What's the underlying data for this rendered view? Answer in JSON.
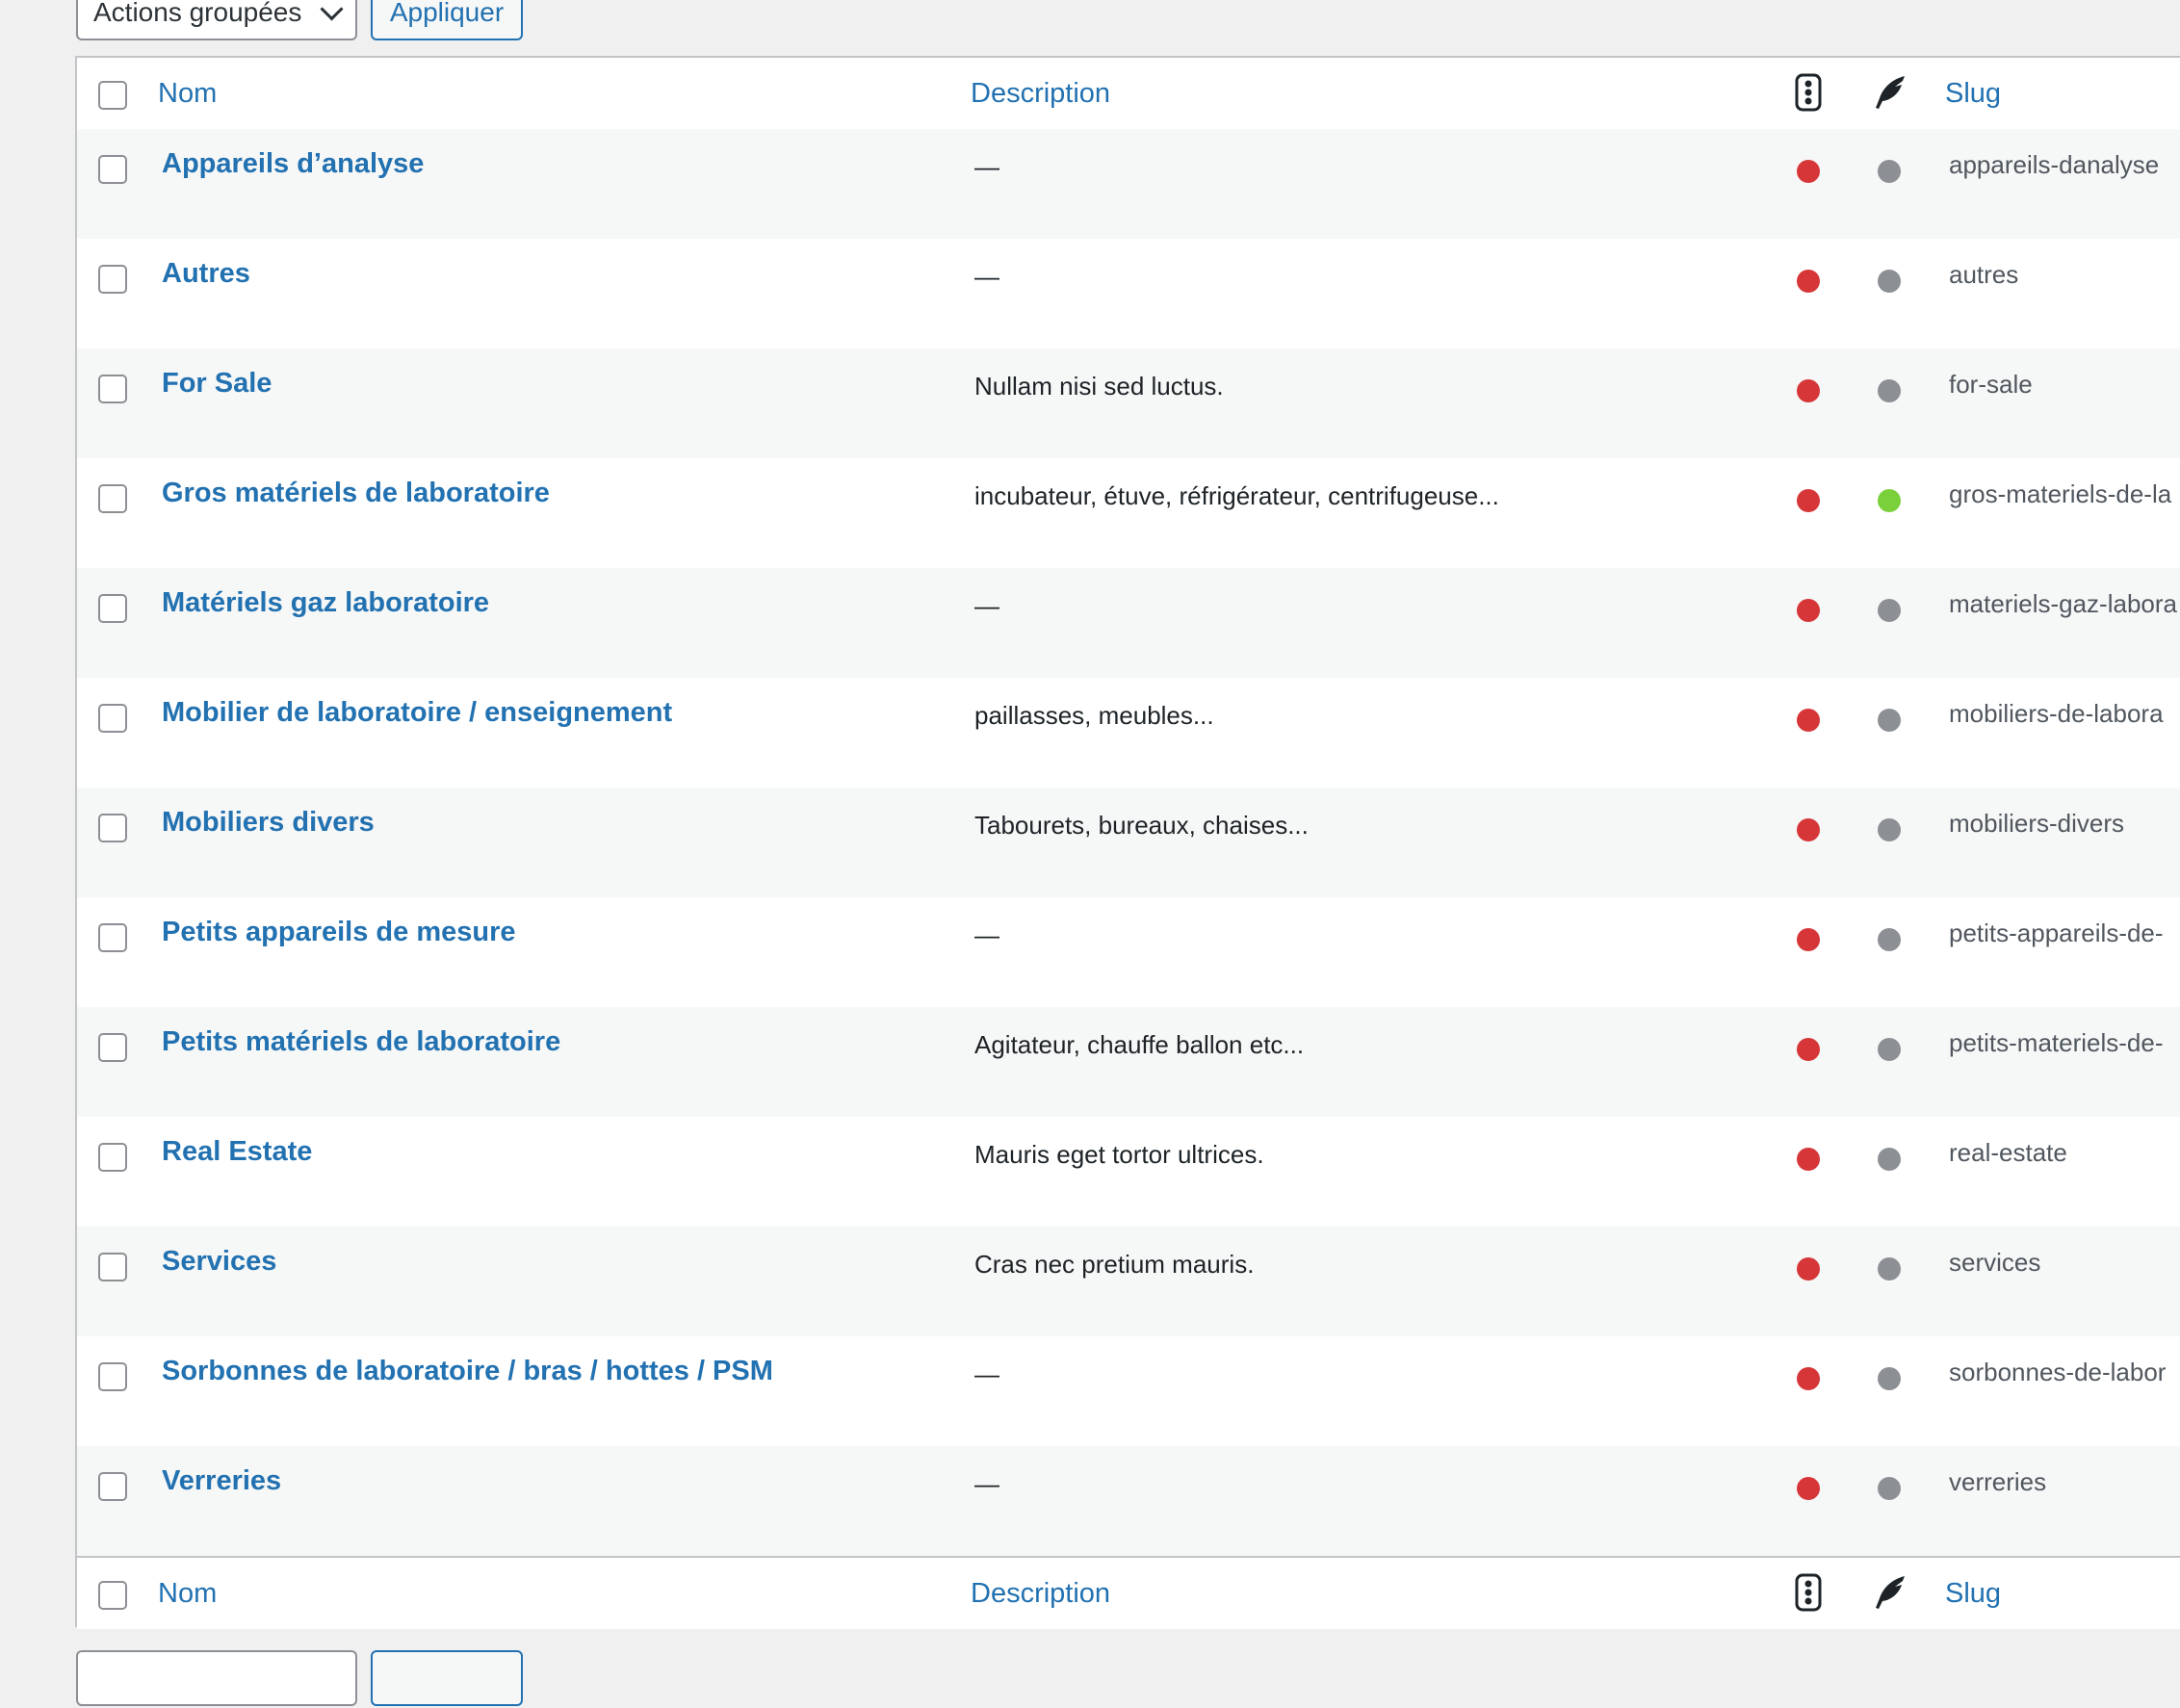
{
  "bulk_actions": {
    "select_label": "Actions groupées",
    "apply_label": "Appliquer"
  },
  "columns": {
    "name": "Nom",
    "description": "Description",
    "seo_icon": "traffic-light-icon",
    "readability_icon": "quill-icon",
    "slug": "Slug"
  },
  "colors": {
    "link": "#2271b1",
    "seo_bad": "#d63638",
    "readability_na": "#8c8f94",
    "readability_good": "#7ad03a"
  },
  "rows": [
    {
      "name": "Appareils d’analyse",
      "description": "—",
      "slug": "appareils-danalyse",
      "seo": "#d63638",
      "readability": "#8c8f94"
    },
    {
      "name": "Autres",
      "description": "—",
      "slug": "autres",
      "seo": "#d63638",
      "readability": "#8c8f94"
    },
    {
      "name": "For Sale",
      "description": "Nullam nisi sed luctus.",
      "slug": "for-sale",
      "seo": "#d63638",
      "readability": "#8c8f94"
    },
    {
      "name": "Gros matériels de laboratoire",
      "description": "incubateur, étuve, réfrigérateur, centrifugeuse...",
      "slug": "gros-materiels-de-la",
      "seo": "#d63638",
      "readability": "#7ad03a"
    },
    {
      "name": "Matériels gaz laboratoire",
      "description": "—",
      "slug": "materiels-gaz-labora",
      "seo": "#d63638",
      "readability": "#8c8f94"
    },
    {
      "name": "Mobilier de laboratoire / enseignement",
      "description": "paillasses, meubles...",
      "slug": "mobiliers-de-labora",
      "seo": "#d63638",
      "readability": "#8c8f94"
    },
    {
      "name": "Mobiliers divers",
      "description": "Tabourets, bureaux, chaises...",
      "slug": "mobiliers-divers",
      "seo": "#d63638",
      "readability": "#8c8f94"
    },
    {
      "name": "Petits appareils de mesure",
      "description": "—",
      "slug": "petits-appareils-de-",
      "seo": "#d63638",
      "readability": "#8c8f94"
    },
    {
      "name": "Petits matériels de laboratoire",
      "description": "Agitateur, chauffe ballon etc...",
      "slug": "petits-materiels-de-",
      "seo": "#d63638",
      "readability": "#8c8f94"
    },
    {
      "name": "Real Estate",
      "description": "Mauris eget tortor ultrices.",
      "slug": "real-estate",
      "seo": "#d63638",
      "readability": "#8c8f94"
    },
    {
      "name": "Services",
      "description": "Cras nec pretium mauris.",
      "slug": "services",
      "seo": "#d63638",
      "readability": "#8c8f94"
    },
    {
      "name": "Sorbonnes de laboratoire / bras / hottes / PSM",
      "description": "—",
      "slug": "sorbonnes-de-labor",
      "seo": "#d63638",
      "readability": "#8c8f94"
    },
    {
      "name": "Verreries",
      "description": "—",
      "slug": "verreries",
      "seo": "#d63638",
      "readability": "#8c8f94"
    }
  ]
}
